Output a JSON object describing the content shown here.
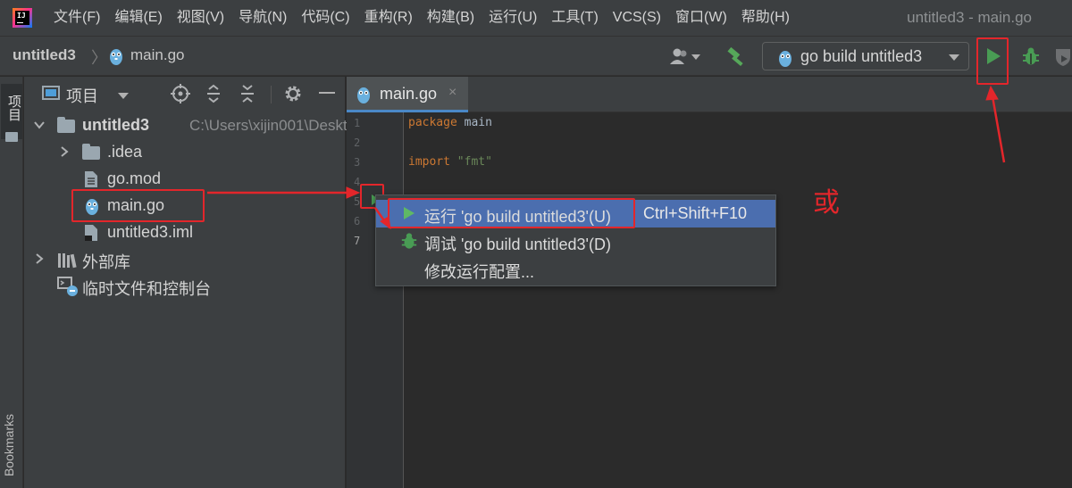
{
  "menubar": {
    "items": [
      "文件(F)",
      "编辑(E)",
      "视图(V)",
      "导航(N)",
      "代码(C)",
      "重构(R)",
      "构建(B)",
      "运行(U)",
      "工具(T)",
      "VCS(S)",
      "窗口(W)",
      "帮助(H)"
    ],
    "window_title": "untitled3 - main.go"
  },
  "navbar": {
    "project": "untitled3",
    "file": "main.go",
    "run_config": "go build untitled3"
  },
  "left_strip": {
    "project_label": "项目",
    "bookmarks_label": "Bookmarks"
  },
  "project_panel": {
    "title": "项目",
    "root_name": "untitled3",
    "root_path": "C:\\Users\\xijin001\\Deskto",
    "items": [
      ".idea",
      "go.mod",
      "main.go",
      "untitled3.iml"
    ],
    "external_libs": "外部库",
    "scratches": "临时文件和控制台"
  },
  "editor": {
    "tab_label": "main.go",
    "tab_close": "×",
    "line_numbers": [
      "1",
      "2",
      "3",
      "4",
      "5",
      "6",
      "7"
    ],
    "code": {
      "l1_kw": "package",
      "l1_id": " main",
      "l3_kw": "import",
      "l3_str": " \"fmt\""
    }
  },
  "popup": {
    "run_label": "运行 'go build untitled3'(U)",
    "run_shortcut": "Ctrl+Shift+F10",
    "debug_label": "调试 'go build untitled3'(D)",
    "modify_label": "修改运行配置..."
  },
  "annotation": {
    "or_label": "或",
    "color": "#e3262b"
  },
  "colors": {
    "selection": "#4b6eaf",
    "run_green": "#499c54",
    "keyword": "#cc7832",
    "string": "#6a8759"
  }
}
